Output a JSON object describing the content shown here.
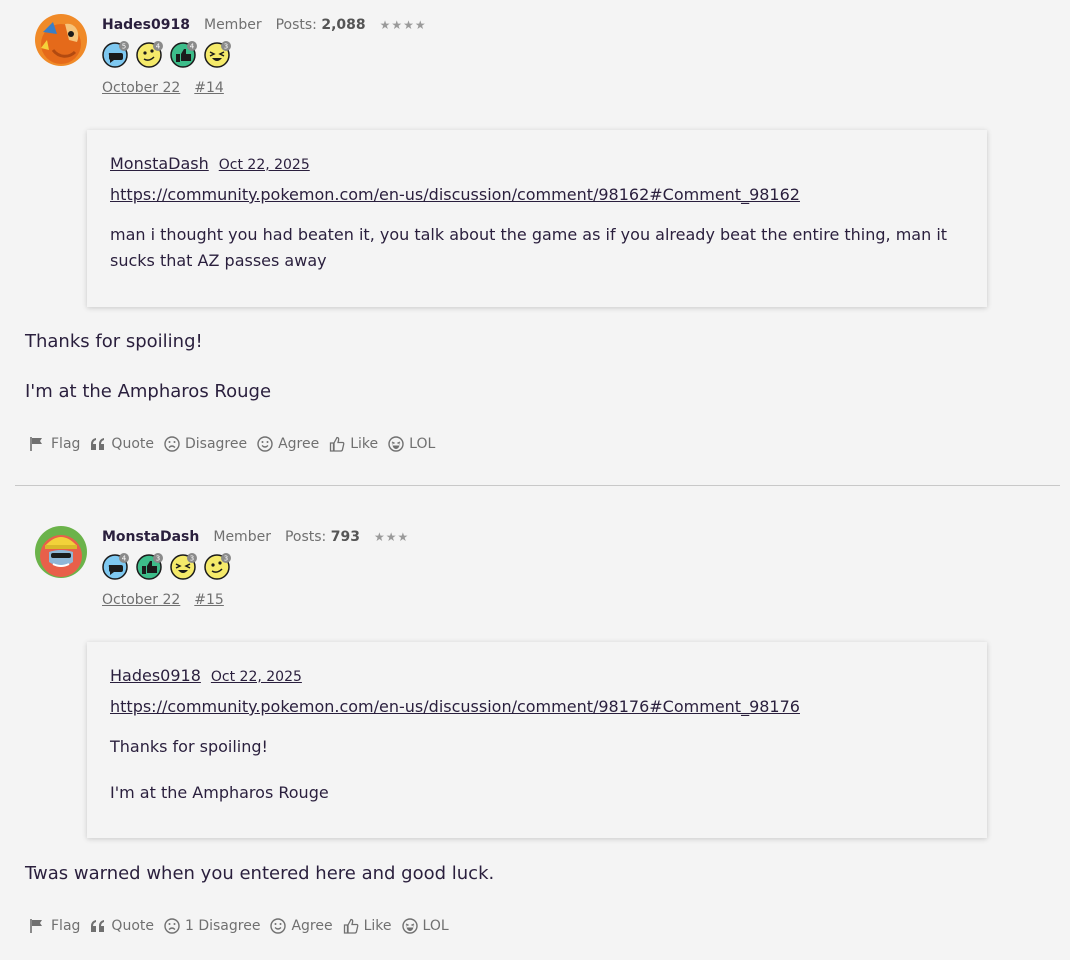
{
  "comments": [
    {
      "author": "Hades0918",
      "role": "Member",
      "posts_label": "Posts:",
      "posts_count": "2,088",
      "stars": "★★★★",
      "badges": [
        {
          "icon": "speech-bubble-icon",
          "count": "5",
          "color": "#7ec8f0"
        },
        {
          "icon": "smiley-icon",
          "count": "4",
          "color": "#f5ea6a"
        },
        {
          "icon": "thumbs-up-icon",
          "count": "4",
          "color": "#3dbd8a"
        },
        {
          "icon": "laughing-icon",
          "count": "3",
          "color": "#f5ea6a"
        }
      ],
      "date": "October 22",
      "number": "#14",
      "quote": {
        "author": "MonstaDash",
        "date": "Oct 22, 2025",
        "link": "https://community.pokemon.com/en-us/discussion/comment/98162#Comment_98162",
        "paragraphs": [
          "man i thought you had beaten it, you talk about the game as if you already beat the entire thing, man it sucks that AZ passes away"
        ]
      },
      "body": [
        "Thanks for spoiling!",
        "I'm at the Ampharos Rouge"
      ],
      "actions": {
        "flag": "Flag",
        "quote": "Quote",
        "disagree": "Disagree",
        "agree": "Agree",
        "like": "Like",
        "lol": "LOL"
      }
    },
    {
      "author": "MonstaDash",
      "role": "Member",
      "posts_label": "Posts:",
      "posts_count": "793",
      "stars": "★★★",
      "badges": [
        {
          "icon": "speech-bubble-icon",
          "count": "4",
          "color": "#7ec8f0"
        },
        {
          "icon": "thumbs-up-icon",
          "count": "3",
          "color": "#3dbd8a"
        },
        {
          "icon": "laughing-icon",
          "count": "3",
          "color": "#f5ea6a"
        },
        {
          "icon": "smiley-icon",
          "count": "3",
          "color": "#f5ea6a"
        }
      ],
      "date": "October 22",
      "number": "#15",
      "quote": {
        "author": "Hades0918",
        "date": "Oct 22, 2025",
        "link": "https://community.pokemon.com/en-us/discussion/comment/98176#Comment_98176",
        "paragraphs": [
          "Thanks for spoiling!",
          "I'm at the Ampharos Rouge"
        ]
      },
      "body": [
        "Twas warned when you entered here and good luck."
      ],
      "actions": {
        "flag": "Flag",
        "quote": "Quote",
        "disagree": "1 Disagree",
        "agree": "Agree",
        "like": "Like",
        "lol": "LOL"
      }
    }
  ]
}
